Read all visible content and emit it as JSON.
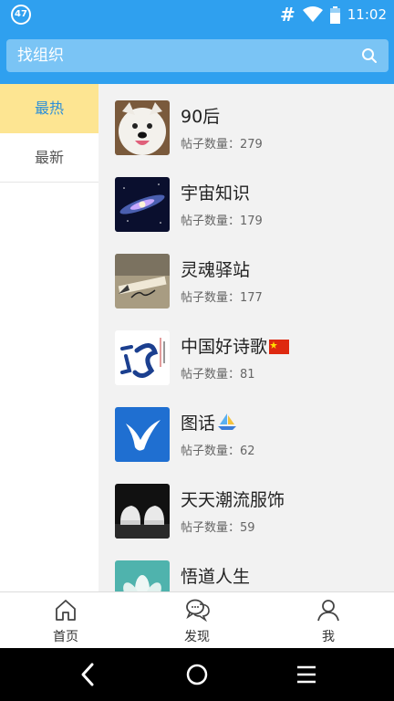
{
  "status_bar": {
    "notification_badge": "47",
    "hash_symbol": "#",
    "time": "11:02",
    "icons": [
      "wifi-icon",
      "battery-icon"
    ]
  },
  "search": {
    "placeholder": "找组织",
    "icon": "search-icon"
  },
  "sidebar": {
    "items": [
      {
        "label": "最热",
        "active": true
      },
      {
        "label": "最新",
        "active": false
      }
    ]
  },
  "groups": [
    {
      "title": "90后",
      "count": "帖子数量：279",
      "thumb": "samoyed-dog"
    },
    {
      "title": "宇宙知识",
      "count": "帖子数量：179",
      "thumb": "galaxy"
    },
    {
      "title": "灵魂驿站",
      "count": "帖子数量：177",
      "thumb": "life-pencil"
    },
    {
      "title": "中国好诗歌",
      "count": "帖子数量：81",
      "thumb": "calligraphy-poem",
      "emoji": "china-flag"
    },
    {
      "title": "图话",
      "count": "帖子数量：62",
      "thumb": "blue-y-logo",
      "emoji": "sailboat"
    },
    {
      "title": "天天潮流服饰",
      "count": "帖子数量：59",
      "thumb": "sneakers"
    },
    {
      "title": "悟道人生",
      "count": "",
      "thumb": "lotus"
    }
  ],
  "tabbar": {
    "tabs": [
      {
        "label": "首页",
        "icon": "home-icon"
      },
      {
        "label": "发现",
        "icon": "chat-bubbles-icon"
      },
      {
        "label": "我",
        "icon": "person-icon"
      }
    ]
  },
  "colors": {
    "primary": "#2fa0ef",
    "search_box": "#7ac4f5",
    "sidebar_active_bg": "#fde592",
    "sidebar_active_text": "#2b8fd9"
  }
}
